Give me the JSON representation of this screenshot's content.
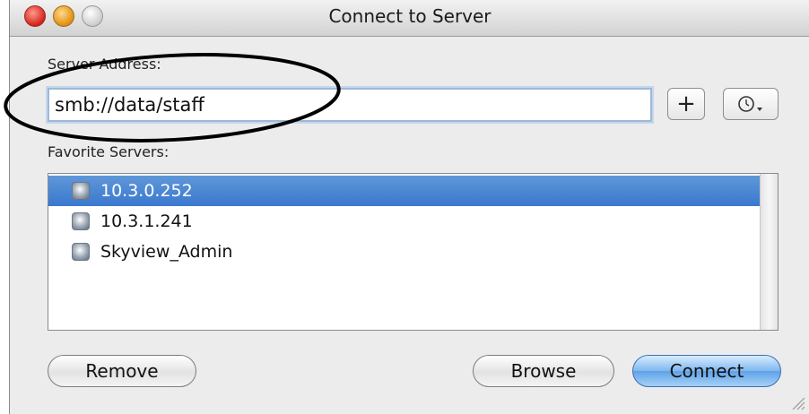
{
  "window": {
    "title": "Connect to Server"
  },
  "address": {
    "label": "Server Address:",
    "value": "smb://data/staff"
  },
  "toolbar": {
    "add_label": "+",
    "recent_icon": "clock-icon"
  },
  "favorites": {
    "label": "Favorite Servers:",
    "items": [
      {
        "name": "10.3.0.252",
        "selected": true
      },
      {
        "name": "10.3.1.241",
        "selected": false
      },
      {
        "name": "Skyview_Admin",
        "selected": false
      }
    ]
  },
  "buttons": {
    "remove": "Remove",
    "browse": "Browse",
    "connect": "Connect"
  },
  "colors": {
    "selection": "#3a78cf",
    "default_button": "#5fa2e8",
    "annotation": "#000000"
  }
}
